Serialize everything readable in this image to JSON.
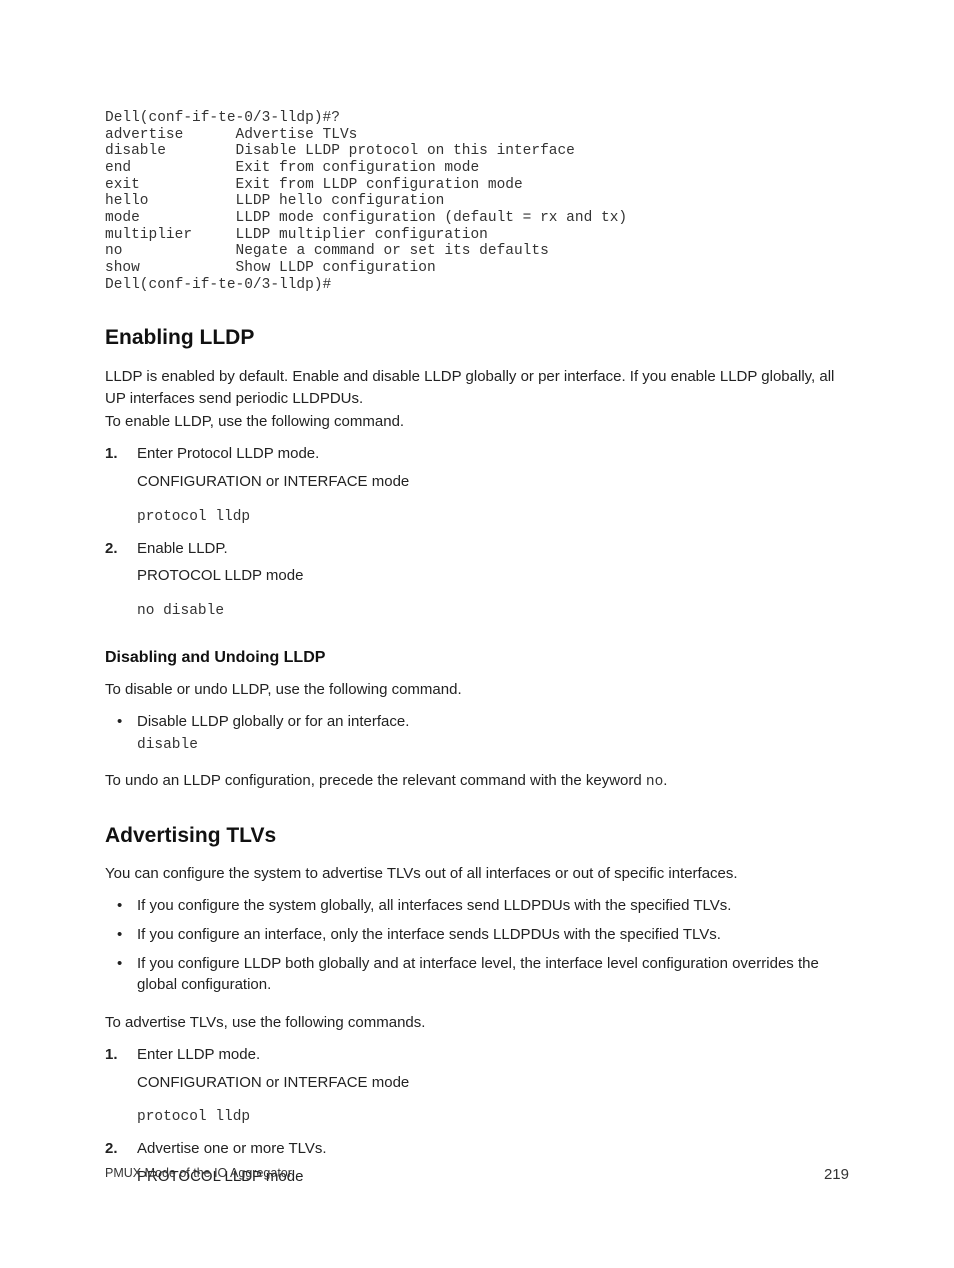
{
  "cli": {
    "prompt_open": "Dell(conf-if-te-0/3-lldp)#?",
    "rows": [
      {
        "cmd": "advertise",
        "desc": "Advertise TLVs"
      },
      {
        "cmd": "disable",
        "desc": "Disable LLDP protocol on this interface"
      },
      {
        "cmd": "end",
        "desc": "Exit from configuration mode"
      },
      {
        "cmd": "exit",
        "desc": "Exit from LLDP configuration mode"
      },
      {
        "cmd": "hello",
        "desc": "LLDP hello configuration"
      },
      {
        "cmd": "mode",
        "desc": "LLDP mode configuration (default = rx and tx)"
      },
      {
        "cmd": "multiplier",
        "desc": "LLDP multiplier configuration"
      },
      {
        "cmd": "no",
        "desc": "Negate a command or set its defaults"
      },
      {
        "cmd": "show",
        "desc": "Show LLDP configuration"
      }
    ],
    "prompt_close": "Dell(conf-if-te-0/3-lldp)#"
  },
  "enable": {
    "heading": "Enabling LLDP",
    "intro1": "LLDP is enabled by default. Enable and disable LLDP globally or per interface. If you enable LLDP globally, all UP interfaces send periodic LLDPDUs.",
    "intro2": "To enable LLDP, use the following command.",
    "steps": [
      {
        "n": "1.",
        "text": "Enter Protocol LLDP mode.",
        "mode": "CONFIGURATION or INTERFACE mode",
        "code": "protocol lldp"
      },
      {
        "n": "2.",
        "text": "Enable LLDP.",
        "mode": "PROTOCOL LLDP mode",
        "code": "no disable"
      }
    ]
  },
  "disable": {
    "heading": "Disabling and Undoing LLDP",
    "intro": "To disable or undo LLDP, use the following command.",
    "bullet_text": "Disable LLDP globally or for an interface.",
    "bullet_code": "disable",
    "undo_pre": "To undo an LLDP configuration, precede the relevant command with the keyword ",
    "undo_code": "no",
    "undo_post": "."
  },
  "adv": {
    "heading": "Advertising TLVs",
    "intro": "You can configure the system to advertise TLVs out of all interfaces or out of specific interfaces.",
    "bullets": [
      "If you configure the system globally, all interfaces send LLDPDUs with the specified TLVs.",
      "If you configure an interface, only the interface sends LLDPDUs with the specified TLVs.",
      "If you configure LLDP both globally and at interface level, the interface level configuration overrides the global configuration."
    ],
    "cmdline": "To advertise TLVs, use the following commands.",
    "steps": [
      {
        "n": "1.",
        "text": "Enter LLDP mode.",
        "mode": "CONFIGURATION or INTERFACE mode",
        "code": "protocol lldp"
      },
      {
        "n": "2.",
        "text": "Advertise one or more TLVs.",
        "mode": "PROTOCOL LLDP mode",
        "code": ""
      }
    ]
  },
  "footer": {
    "left": "PMUX Mode of the IO Aggregator",
    "right": "219"
  }
}
